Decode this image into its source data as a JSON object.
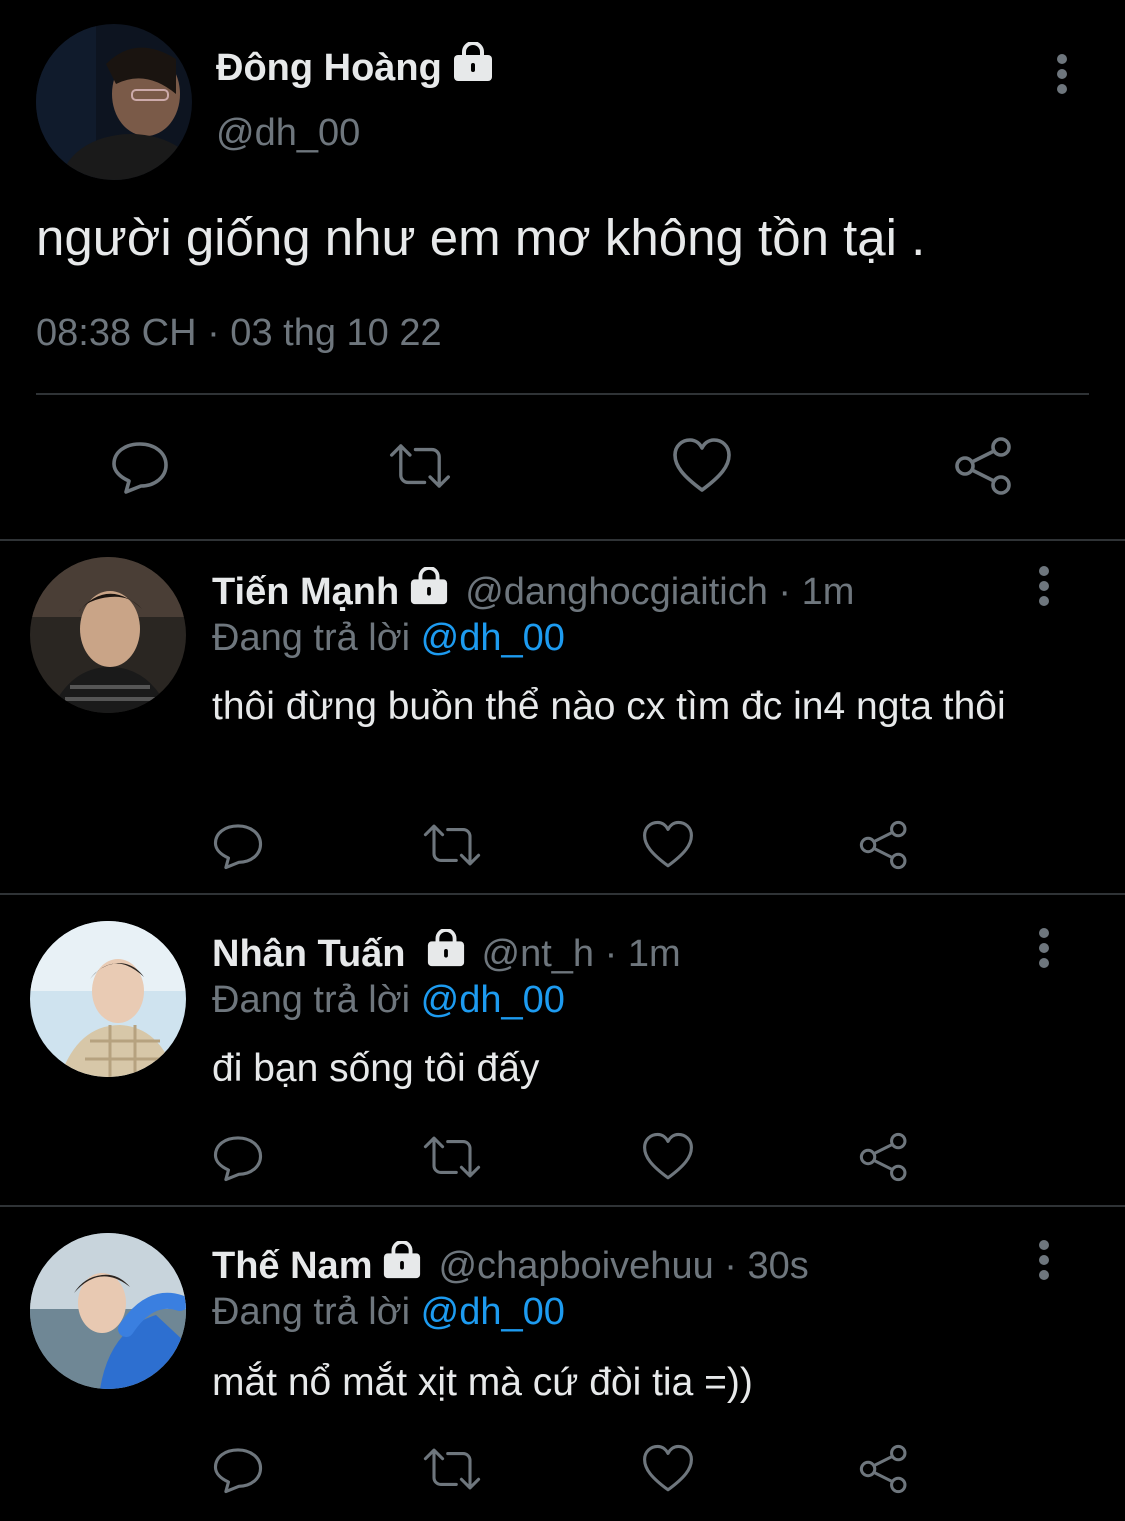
{
  "main_tweet": {
    "author_name": "Đông Hoàng",
    "handle": "@dh_00",
    "text": "người giống như em mơ không tồn tại .",
    "timestamp": "08:38 CH · 03 thg 10 22"
  },
  "replies": [
    {
      "name": "Tiến Mạnh",
      "meta": "@danghocgiaitich · 1m",
      "replying_prefix": "Đang trả lời",
      "replying_to": "@dh_00",
      "text": "thôi đừng buồn thể nào cx tìm đc in4 ngta thôi"
    },
    {
      "name": "Nhân Tuấn",
      "meta": "@nt_h · 1m",
      "replying_prefix": "Đang trả lời",
      "replying_to": "@dh_00",
      "text": "đi bạn sống tôi đấy"
    },
    {
      "name": "Thế Nam",
      "meta": "@chapboivehuu · 30s",
      "replying_prefix": "Đang trả lời",
      "replying_to": "@dh_00",
      "text": "mắt nổ mắt xịt mà cứ đòi tia =))"
    }
  ],
  "icons": {
    "reply": "reply-icon",
    "retweet": "retweet-icon",
    "like": "heart-icon",
    "share": "share-icon",
    "more": "more-vertical-icon",
    "lock": "lock-icon"
  },
  "colors": {
    "background": "#000000",
    "text": "#e7e9ea",
    "secondary": "#6e767d",
    "mention": "#1d9bf0",
    "divider": "#2f3336"
  }
}
